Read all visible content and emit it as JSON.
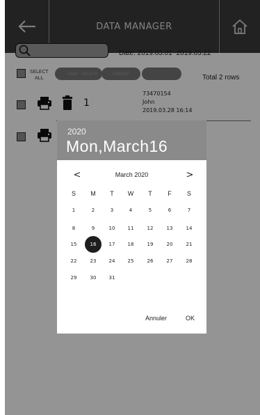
{
  "header": {
    "title": "DATA MANAGER",
    "back_icon": "arrow-left-icon",
    "home_icon": "home-icon"
  },
  "toolbar": {
    "search_value": "",
    "date_range": "Date: 2019.03.01~2019.05.22",
    "select_all": [
      "SELECT",
      "ALL"
    ],
    "buttons": [
      "SEARCH",
      "DELETE",
      "EXPORT",
      ""
    ],
    "total_rows": "Total 2 rows"
  },
  "rows": [
    {
      "number": "1",
      "id": "73470154",
      "name": "John",
      "datetime": "2019.03.28 16:14",
      "icons": [
        "printer-icon",
        "trash-icon"
      ]
    },
    {
      "number": "",
      "icons": [
        "printer-icon"
      ]
    }
  ],
  "date_picker": {
    "year": "2020",
    "selected_label": "Mon,March16",
    "month_label": "March 2020",
    "prev": "<",
    "next": ">",
    "weekdays": [
      "S",
      "M",
      "T",
      "W",
      "T",
      "F",
      "S"
    ],
    "weeks": [
      [
        "1",
        "2",
        "3",
        "4",
        "5",
        "6",
        "7"
      ],
      [
        "8",
        "9",
        "10",
        "11",
        "12",
        "13",
        "14"
      ],
      [
        "15",
        "16",
        "17",
        "18",
        "19",
        "20",
        "21"
      ],
      [
        "22",
        "23",
        "24",
        "25",
        "26",
        "27",
        "28"
      ],
      [
        "29",
        "30",
        "31",
        "",
        "",
        "",
        ""
      ]
    ],
    "selected_day": "16",
    "cancel_label": "Annuler",
    "ok_label": "OK"
  },
  "colors": {
    "header_bg": "#3c3c3c",
    "overlay": "rgba(0,0,0,0.42)",
    "picker_header_bg": "#8a8a8a",
    "selected_day_bg": "#1e1e1e"
  }
}
